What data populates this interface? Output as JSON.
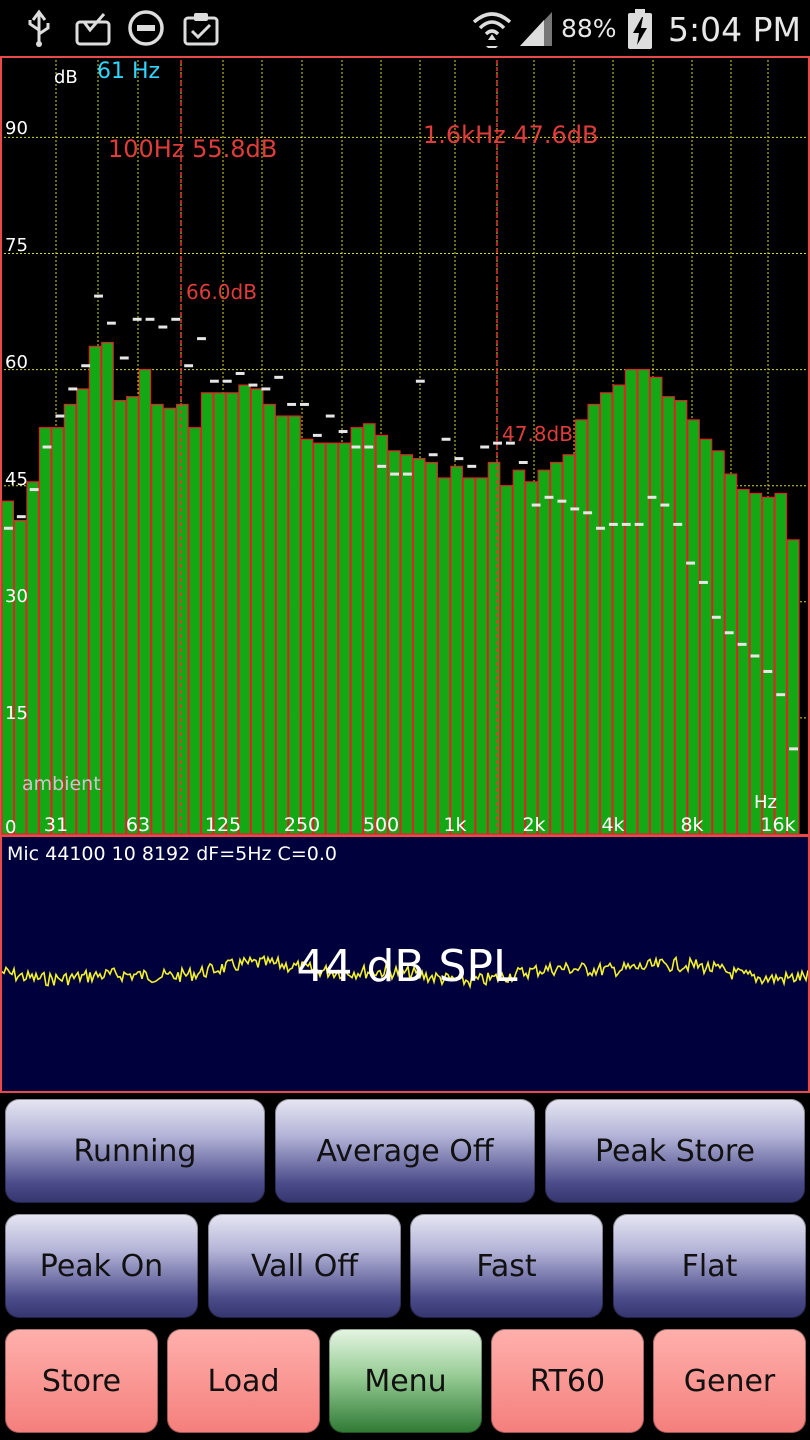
{
  "status_bar": {
    "battery": "88%",
    "time": "5:04 PM",
    "icons": [
      "usb-icon",
      "inbox-check-icon",
      "do-not-disturb-icon",
      "clipboard-check-icon",
      "wifi-icon",
      "signal-icon",
      "battery-charging-icon"
    ]
  },
  "spectrum": {
    "unit_label": "dB",
    "cursor_freq": "61 Hz",
    "marker1": "100Hz  55.8dB",
    "marker2": "1.6kHz  47.6dB",
    "peak_label": "66.0dB",
    "peak2_label": "47.8dB",
    "ambient_label": "ambient",
    "hz_label": "Hz",
    "y_ticks": [
      "90",
      "75",
      "60",
      "45",
      "30",
      "15",
      "0"
    ],
    "x_ticks": [
      "31",
      "63",
      "125",
      "250",
      "500",
      "1k",
      "2k",
      "4k",
      "8k",
      "16k"
    ]
  },
  "chart_data": {
    "type": "bar",
    "ylim": [
      0,
      100
    ],
    "series": [
      {
        "values": [
          43,
          40.5,
          45.5,
          52.5,
          52.5,
          55.5,
          57.5,
          63,
          63.5,
          56,
          56.5,
          60,
          55.5,
          55,
          55.5,
          52.5,
          57,
          57,
          57,
          58,
          57.5,
          55.5,
          54,
          54,
          51,
          50.5,
          50.5,
          50.5,
          52.5,
          53,
          51.5,
          49.5,
          49,
          48.5,
          48,
          46,
          47.5,
          46,
          46,
          48,
          45,
          47,
          45.5,
          47,
          48,
          49,
          53.5,
          55.5,
          57,
          58,
          60,
          60,
          59,
          56.5,
          56,
          53.5,
          51,
          49.5,
          46.5,
          44.5,
          44,
          43.5,
          44,
          38
        ]
      },
      {
        "values": [
          39.5,
          41,
          44.5,
          50,
          54,
          57.5,
          60.5,
          69.5,
          66,
          61.5,
          66.5,
          66.5,
          65.5,
          66.5,
          60.5,
          64,
          58.5,
          58.5,
          59.5,
          58,
          57.5,
          59,
          55.5,
          55.5,
          51.5,
          54,
          52,
          50,
          50,
          47.5,
          46.5,
          46.5,
          58.5,
          49,
          51,
          48.5,
          47.5,
          50,
          50.5,
          50.5,
          48,
          42.5,
          43.5,
          43,
          42,
          41.5,
          39.5,
          40,
          40,
          40,
          43.5,
          42.5,
          40,
          35,
          32.5,
          28,
          26,
          24.5,
          23,
          21,
          18,
          11
        ]
      }
    ]
  },
  "wave": {
    "spl": "44 dB SPL",
    "info": "Mic 44100 10 8192 dF=5Hz C=0.0"
  },
  "buttons": {
    "running": "Running",
    "average": "Average Off",
    "peak_store": "Peak Store",
    "peak": "Peak On",
    "vall": "Vall Off",
    "fast": "Fast",
    "flat": "Flat",
    "store": "Store",
    "load": "Load",
    "menu": "Menu",
    "rt60": "RT60",
    "gener": "Gener"
  }
}
